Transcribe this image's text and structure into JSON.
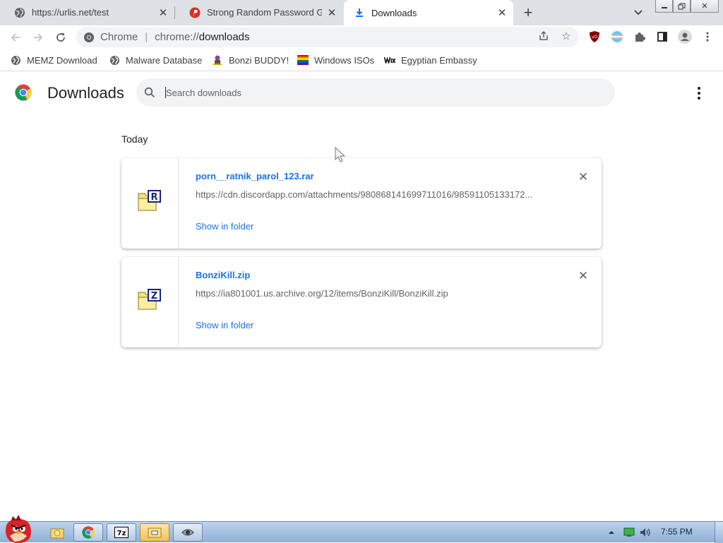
{
  "tabs": [
    {
      "title": "https://urlis.net/test",
      "icon": "globe-icon"
    },
    {
      "title": "Strong Random Password Gen",
      "icon": "password-generator-icon"
    },
    {
      "title": "Downloads",
      "icon": "download-icon"
    }
  ],
  "toolbar": {
    "scheme_label": "Chrome",
    "url_prefix": "chrome://",
    "url_path": "downloads"
  },
  "bookmarks": [
    {
      "label": "MEMZ Download",
      "icon": "globe-icon"
    },
    {
      "label": "Malware Database",
      "icon": "globe-icon"
    },
    {
      "label": "Bonzi BUDDY!",
      "icon": "bonzi-icon"
    },
    {
      "label": "Windows ISOs",
      "icon": "rainbow-flag-icon"
    },
    {
      "label": "Egyptian Embassy",
      "icon": "wix-icon"
    }
  ],
  "page": {
    "title": "Downloads",
    "search_placeholder": "Search downloads",
    "section_label": "Today"
  },
  "downloads": [
    {
      "filename": "porn__ratnik_parol_123.rar",
      "url": "https://cdn.discordapp.com/attachments/980868141699711016/98591105133172...",
      "action": "Show in folder",
      "icon": "rar-archive-icon"
    },
    {
      "filename": "BonziKill.zip",
      "url": "https://ia801001.us.archive.org/12/items/BonziKill/BonziKill.zip",
      "action": "Show in folder",
      "icon": "zip-archive-icon"
    }
  ],
  "taskbar": {
    "clock": "7:55 PM"
  },
  "colors": {
    "link": "#1a73e8",
    "tabstrip": "#dee1e6",
    "omnibox": "#f1f3f4"
  }
}
